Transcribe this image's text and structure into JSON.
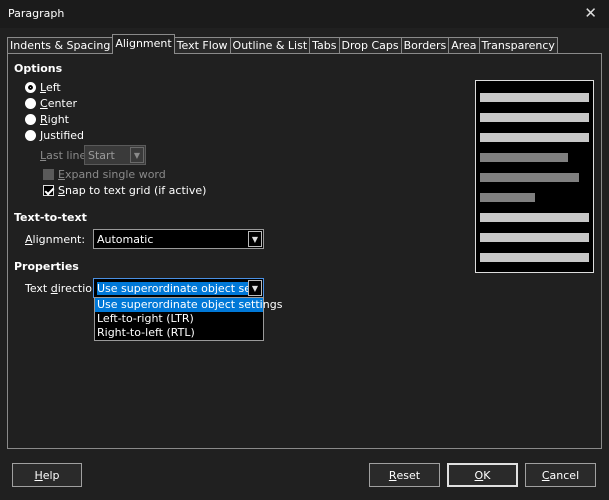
{
  "window": {
    "title": "Paragraph"
  },
  "tabs": [
    {
      "label": "Indents & Spacing",
      "active": false
    },
    {
      "label": "Alignment",
      "active": true
    },
    {
      "label": "Text Flow",
      "active": false
    },
    {
      "label": "Outline & List",
      "active": false
    },
    {
      "label": "Tabs",
      "active": false
    },
    {
      "label": "Drop Caps",
      "active": false
    },
    {
      "label": "Borders",
      "active": false
    },
    {
      "label": "Area",
      "active": false
    },
    {
      "label": "Transparency",
      "active": false
    }
  ],
  "options": {
    "heading": "Options",
    "radios": [
      {
        "mn": "L",
        "rest": "eft",
        "checked": true
      },
      {
        "mn": "C",
        "rest": "enter",
        "checked": false
      },
      {
        "mn": "R",
        "rest": "ight",
        "checked": false
      },
      {
        "mn": "J",
        "rest": "ustified",
        "checked": false
      }
    ],
    "last_line_mn": "L",
    "last_line_rest": "ast line:",
    "last_line_value": "Start",
    "expand_mn": "E",
    "expand_rest": "xpand single word",
    "snap_mn": "S",
    "snap_rest": "nap to text grid (if active)"
  },
  "text_to_text": {
    "heading": "Text-to-text",
    "alignment_mn": "A",
    "alignment_rest": "lignment:",
    "alignment_value": "Automatic"
  },
  "properties": {
    "heading": "Properties",
    "direction_pre": "Text ",
    "direction_mn": "d",
    "direction_rest": "irection:",
    "direction_value": "Use superordinate object settings",
    "direction_options": [
      "Use superordinate object settings",
      "Left-to-right (LTR)",
      "Right-to-left (RTL)"
    ]
  },
  "preview": {
    "line_fill": "#c8c8c8",
    "last_fill": "#808080"
  },
  "buttons": {
    "help_mn": "H",
    "help_rest": "elp",
    "reset_mn": "R",
    "reset_rest": "eset",
    "ok_mn": "O",
    "ok_rest": "K",
    "cancel_mn": "C",
    "cancel_rest": "ancel"
  }
}
